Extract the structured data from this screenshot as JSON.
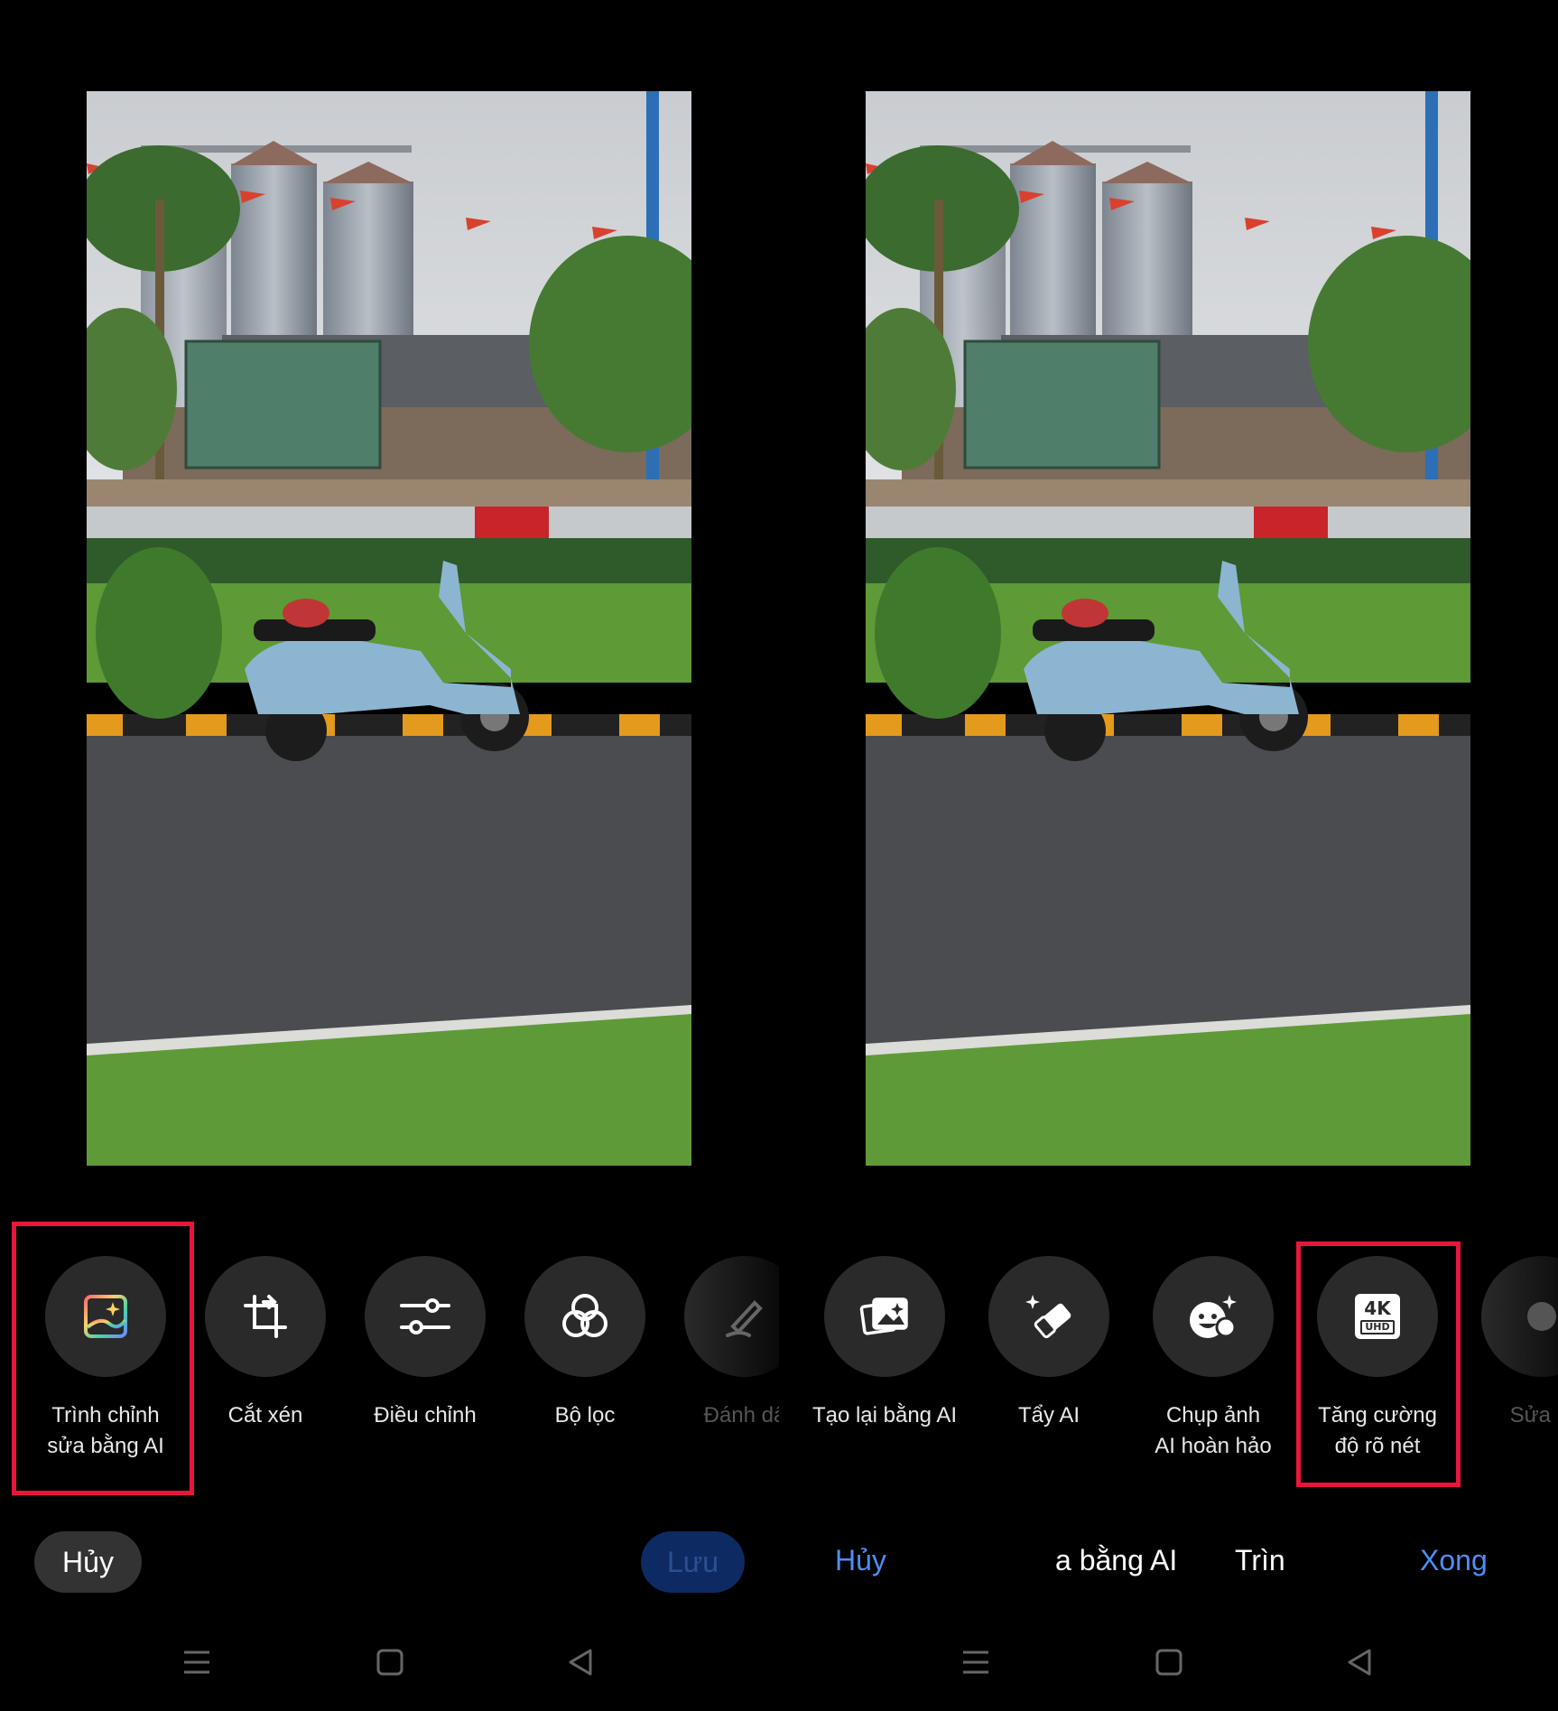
{
  "left": {
    "tools": [
      {
        "label": "Trình chỉnh\nsửa bằng AI",
        "icon": "ai-photo-edit-icon"
      },
      {
        "label": "Cắt xén",
        "icon": "crop-icon"
      },
      {
        "label": "Điều chỉnh",
        "icon": "adjust-sliders-icon"
      },
      {
        "label": "Bộ lọc",
        "icon": "filter-circles-icon"
      },
      {
        "label": "Đánh dấ",
        "icon": "markup-pen-icon"
      }
    ],
    "cancel": "Hủy",
    "save": "Lưu"
  },
  "right": {
    "tools": [
      {
        "label": "Tạo lại bằng AI",
        "icon": "ai-regenerate-icon"
      },
      {
        "label": "Tẩy AI",
        "icon": "ai-eraser-icon"
      },
      {
        "label": "Chụp ảnh\nAI hoàn hảo",
        "icon": "ai-perfect-shot-icon"
      },
      {
        "label": "Tăng cường\nđộ rõ nét",
        "icon": "4k-uhd-icon"
      },
      {
        "label": "Sửa lỗ",
        "icon": "fix-icon"
      }
    ],
    "cancel": "Hủy",
    "tabs": [
      "a bằng AI",
      "Trìn"
    ],
    "done": "Xong",
    "uhd_text": {
      "big": "4K",
      "small": "UHD"
    }
  },
  "colors": {
    "highlight": "#e8163c",
    "accent_blue": "#4f8ef7",
    "save_dim": "#0e2a63"
  }
}
